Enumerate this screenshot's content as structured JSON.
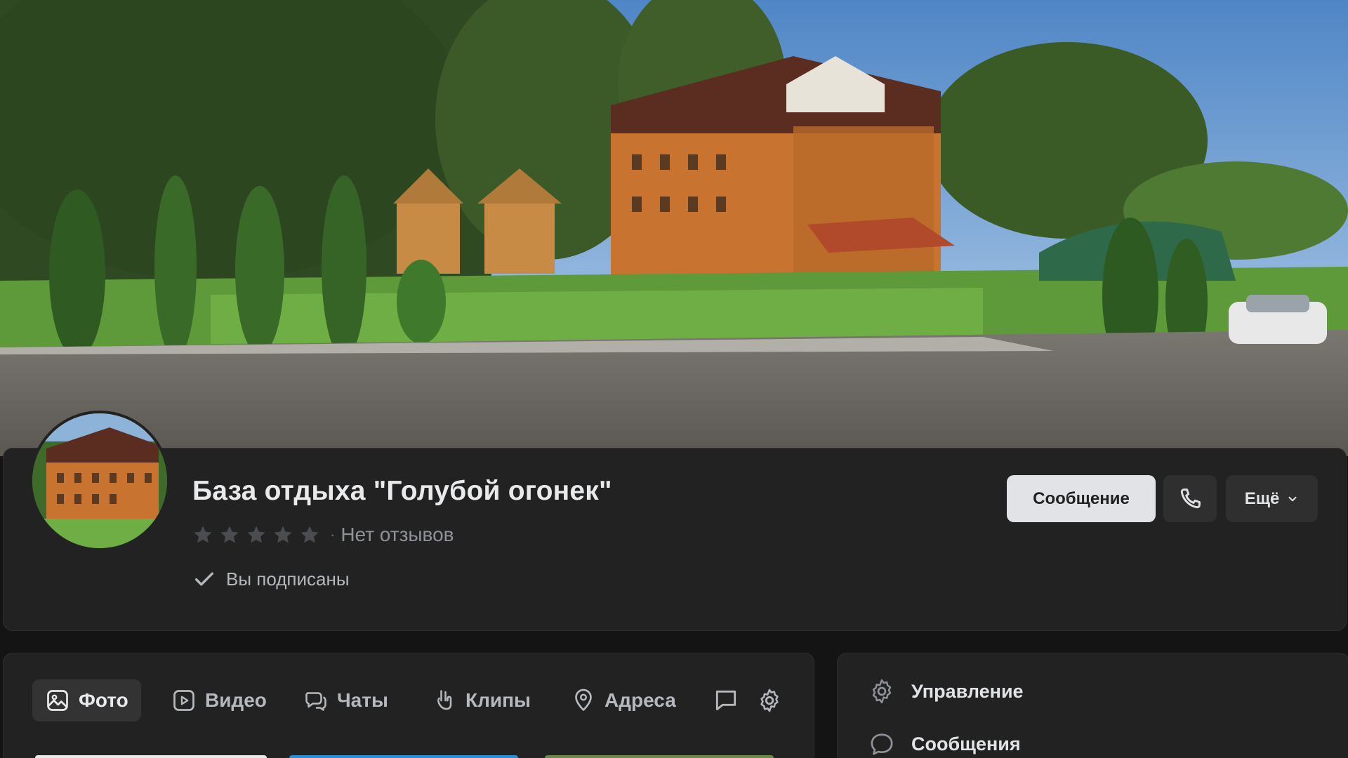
{
  "cover": {
    "image": "resort-cover-photo"
  },
  "group": {
    "name": "База отдыха \"Голубой огонек\"",
    "rating_stars": 5,
    "rating_separator": "·",
    "reviews_text": "Нет отзывов",
    "subscribed_text": "Вы подписаны"
  },
  "actions": {
    "message": "Сообщение",
    "call_icon": "phone-icon",
    "more": "Ещё"
  },
  "tabs": [
    {
      "label": "Фото",
      "icon": "photo-icon",
      "active": true
    },
    {
      "label": "Видео",
      "icon": "video-icon",
      "active": false
    },
    {
      "label": "Чаты",
      "icon": "chats-icon",
      "active": false
    },
    {
      "label": "Клипы",
      "icon": "clips-icon",
      "active": false
    },
    {
      "label": "Адреса",
      "icon": "location-icon",
      "active": false
    }
  ],
  "tab_extra_icons": [
    "comment-icon",
    "settings-icon"
  ],
  "side_menu": [
    {
      "label": "Управление",
      "icon": "gear-icon"
    },
    {
      "label": "Сообщения",
      "icon": "message-bubble-icon"
    }
  ],
  "colors": {
    "background": "#141414",
    "card": "#222222",
    "primary_button": "#e1e3e6",
    "secondary_button": "#2f2f2f"
  }
}
